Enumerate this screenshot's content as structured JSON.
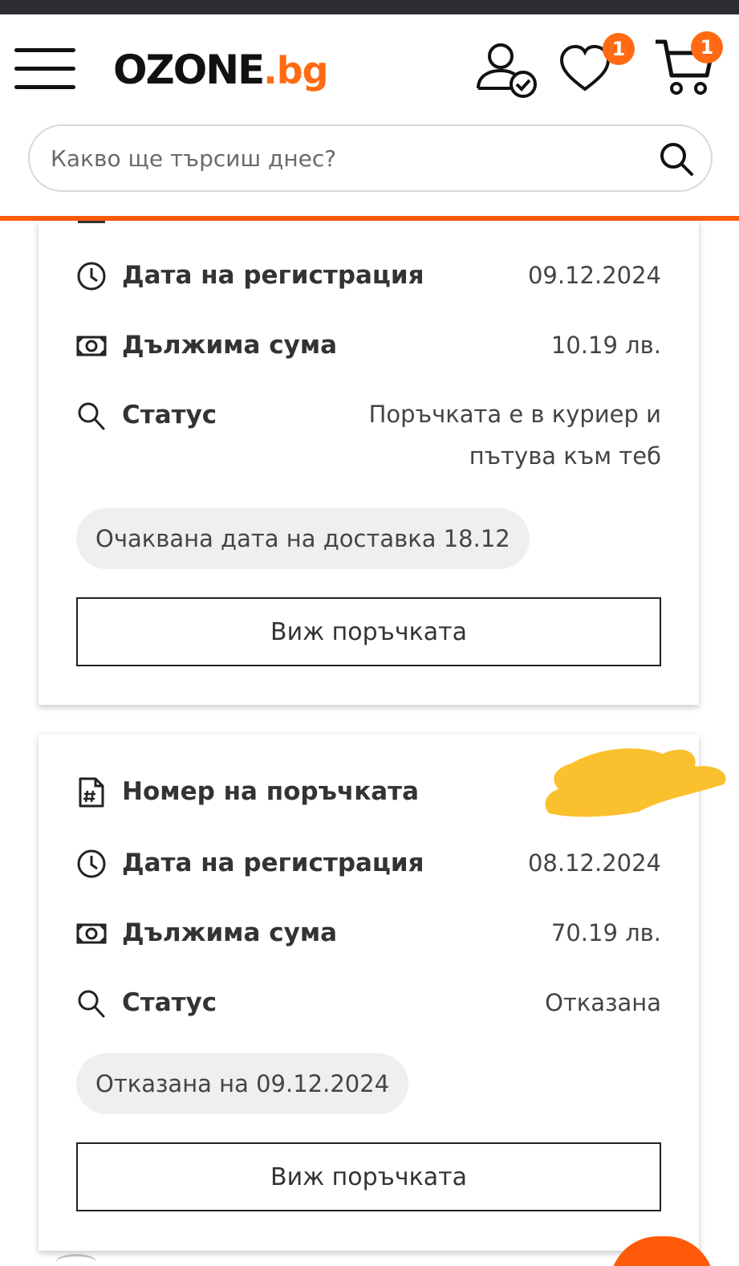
{
  "header": {
    "logo_main": "OZONE",
    "logo_tld": ".bg",
    "wishlist_count": "1",
    "cart_count": "1"
  },
  "search": {
    "placeholder": "Какво ще търсиш днес?"
  },
  "orders": [
    {
      "registration_label": "Дата на регистрация",
      "registration_date": "09.12.2024",
      "amount_label": "Дължима сума",
      "amount": "10.19 лв.",
      "status_label": "Статус",
      "status": "Поръчката е в куриер и пътува към теб",
      "note": "Очаквана дата на доставка 18.12",
      "view_button": "Виж поръчката"
    },
    {
      "number_label": "Номер на поръчката",
      "registration_label": "Дата на регистрация",
      "registration_date": "08.12.2024",
      "amount_label": "Дължима сума",
      "amount": "70.19 лв.",
      "status_label": "Статус",
      "status": "Отказана",
      "note": "Отказана на 09.12.2024",
      "view_button": "Виж поръчката"
    }
  ],
  "colors": {
    "accent": "#ff6a13",
    "header_line": "#ff5a0a",
    "redaction": "#fbc02d",
    "status_bar": "#2b2d31"
  }
}
